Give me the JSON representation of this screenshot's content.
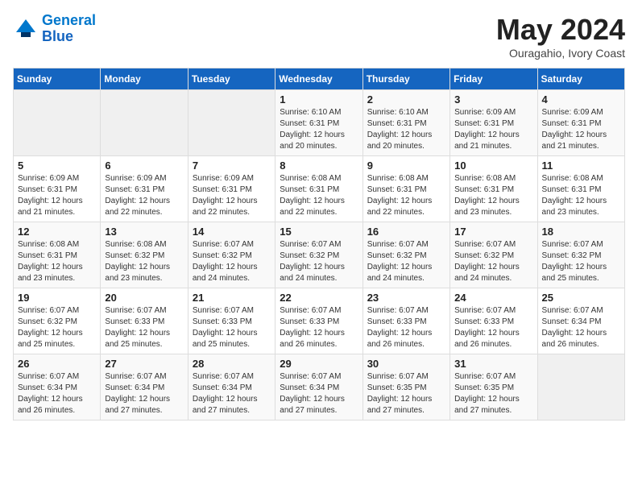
{
  "header": {
    "logo_line1": "General",
    "logo_line2": "Blue",
    "month_title": "May 2024",
    "location": "Ouragahio, Ivory Coast"
  },
  "weekdays": [
    "Sunday",
    "Monday",
    "Tuesday",
    "Wednesday",
    "Thursday",
    "Friday",
    "Saturday"
  ],
  "weeks": [
    [
      {
        "day": "",
        "info": ""
      },
      {
        "day": "",
        "info": ""
      },
      {
        "day": "",
        "info": ""
      },
      {
        "day": "1",
        "info": "Sunrise: 6:10 AM\nSunset: 6:31 PM\nDaylight: 12 hours\nand 20 minutes."
      },
      {
        "day": "2",
        "info": "Sunrise: 6:10 AM\nSunset: 6:31 PM\nDaylight: 12 hours\nand 20 minutes."
      },
      {
        "day": "3",
        "info": "Sunrise: 6:09 AM\nSunset: 6:31 PM\nDaylight: 12 hours\nand 21 minutes."
      },
      {
        "day": "4",
        "info": "Sunrise: 6:09 AM\nSunset: 6:31 PM\nDaylight: 12 hours\nand 21 minutes."
      }
    ],
    [
      {
        "day": "5",
        "info": "Sunrise: 6:09 AM\nSunset: 6:31 PM\nDaylight: 12 hours\nand 21 minutes."
      },
      {
        "day": "6",
        "info": "Sunrise: 6:09 AM\nSunset: 6:31 PM\nDaylight: 12 hours\nand 22 minutes."
      },
      {
        "day": "7",
        "info": "Sunrise: 6:09 AM\nSunset: 6:31 PM\nDaylight: 12 hours\nand 22 minutes."
      },
      {
        "day": "8",
        "info": "Sunrise: 6:08 AM\nSunset: 6:31 PM\nDaylight: 12 hours\nand 22 minutes."
      },
      {
        "day": "9",
        "info": "Sunrise: 6:08 AM\nSunset: 6:31 PM\nDaylight: 12 hours\nand 22 minutes."
      },
      {
        "day": "10",
        "info": "Sunrise: 6:08 AM\nSunset: 6:31 PM\nDaylight: 12 hours\nand 23 minutes."
      },
      {
        "day": "11",
        "info": "Sunrise: 6:08 AM\nSunset: 6:31 PM\nDaylight: 12 hours\nand 23 minutes."
      }
    ],
    [
      {
        "day": "12",
        "info": "Sunrise: 6:08 AM\nSunset: 6:31 PM\nDaylight: 12 hours\nand 23 minutes."
      },
      {
        "day": "13",
        "info": "Sunrise: 6:08 AM\nSunset: 6:32 PM\nDaylight: 12 hours\nand 23 minutes."
      },
      {
        "day": "14",
        "info": "Sunrise: 6:07 AM\nSunset: 6:32 PM\nDaylight: 12 hours\nand 24 minutes."
      },
      {
        "day": "15",
        "info": "Sunrise: 6:07 AM\nSunset: 6:32 PM\nDaylight: 12 hours\nand 24 minutes."
      },
      {
        "day": "16",
        "info": "Sunrise: 6:07 AM\nSunset: 6:32 PM\nDaylight: 12 hours\nand 24 minutes."
      },
      {
        "day": "17",
        "info": "Sunrise: 6:07 AM\nSunset: 6:32 PM\nDaylight: 12 hours\nand 24 minutes."
      },
      {
        "day": "18",
        "info": "Sunrise: 6:07 AM\nSunset: 6:32 PM\nDaylight: 12 hours\nand 25 minutes."
      }
    ],
    [
      {
        "day": "19",
        "info": "Sunrise: 6:07 AM\nSunset: 6:32 PM\nDaylight: 12 hours\nand 25 minutes."
      },
      {
        "day": "20",
        "info": "Sunrise: 6:07 AM\nSunset: 6:33 PM\nDaylight: 12 hours\nand 25 minutes."
      },
      {
        "day": "21",
        "info": "Sunrise: 6:07 AM\nSunset: 6:33 PM\nDaylight: 12 hours\nand 25 minutes."
      },
      {
        "day": "22",
        "info": "Sunrise: 6:07 AM\nSunset: 6:33 PM\nDaylight: 12 hours\nand 26 minutes."
      },
      {
        "day": "23",
        "info": "Sunrise: 6:07 AM\nSunset: 6:33 PM\nDaylight: 12 hours\nand 26 minutes."
      },
      {
        "day": "24",
        "info": "Sunrise: 6:07 AM\nSunset: 6:33 PM\nDaylight: 12 hours\nand 26 minutes."
      },
      {
        "day": "25",
        "info": "Sunrise: 6:07 AM\nSunset: 6:34 PM\nDaylight: 12 hours\nand 26 minutes."
      }
    ],
    [
      {
        "day": "26",
        "info": "Sunrise: 6:07 AM\nSunset: 6:34 PM\nDaylight: 12 hours\nand 26 minutes."
      },
      {
        "day": "27",
        "info": "Sunrise: 6:07 AM\nSunset: 6:34 PM\nDaylight: 12 hours\nand 27 minutes."
      },
      {
        "day": "28",
        "info": "Sunrise: 6:07 AM\nSunset: 6:34 PM\nDaylight: 12 hours\nand 27 minutes."
      },
      {
        "day": "29",
        "info": "Sunrise: 6:07 AM\nSunset: 6:34 PM\nDaylight: 12 hours\nand 27 minutes."
      },
      {
        "day": "30",
        "info": "Sunrise: 6:07 AM\nSunset: 6:35 PM\nDaylight: 12 hours\nand 27 minutes."
      },
      {
        "day": "31",
        "info": "Sunrise: 6:07 AM\nSunset: 6:35 PM\nDaylight: 12 hours\nand 27 minutes."
      },
      {
        "day": "",
        "info": ""
      }
    ]
  ]
}
